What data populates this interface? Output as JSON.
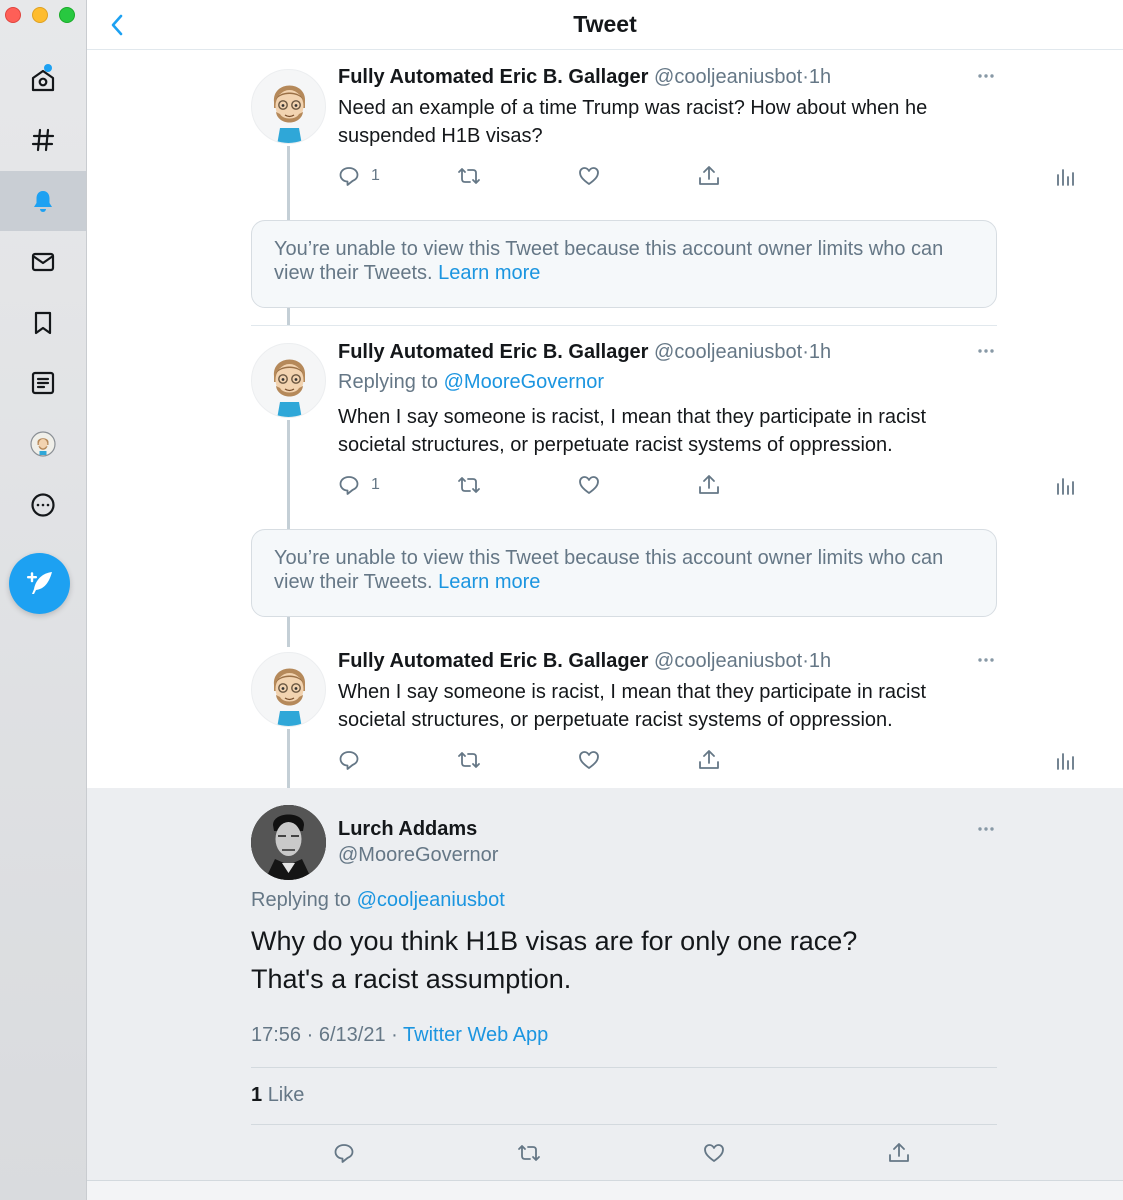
{
  "window": {
    "title": "Tweet"
  },
  "colors": {
    "accent": "#1da1f2",
    "link": "#1b95e0",
    "muted": "#657786",
    "text": "#14171a"
  },
  "sidebar": {
    "items": [
      {
        "name": "home-icon"
      },
      {
        "name": "explore-icon"
      },
      {
        "name": "notifications-icon",
        "active": true
      },
      {
        "name": "messages-icon"
      },
      {
        "name": "bookmarks-icon"
      },
      {
        "name": "lists-icon"
      },
      {
        "name": "profile-avatar"
      },
      {
        "name": "more-icon"
      }
    ],
    "compose": "compose-tweet-icon"
  },
  "thread": [
    {
      "name": "Fully Automated Eric B. Gallager",
      "handle": "@cooljeaniusbot",
      "sep": "·",
      "time": "1h",
      "text": "Need an example of a time Trump was racist? How about when he suspended H1B visas?",
      "reply_count": "1"
    },
    {
      "name": "Fully Automated Eric B. Gallager",
      "handle": "@cooljeaniusbot",
      "sep": "·",
      "time": "1h",
      "replying_prefix": "Replying to",
      "replying_to": "@MooreGovernor",
      "text": "When I say someone is racist, I mean that they participate in racist societal structures, or perpetuate racist systems of oppression.",
      "reply_count": "1"
    },
    {
      "name": "Fully Automated Eric B. Gallager",
      "handle": "@cooljeaniusbot",
      "sep": "·",
      "time": "1h",
      "text": "When I say someone is racist, I mean that they participate in racist societal structures, or perpetuate racist systems of oppression.",
      "reply_count": ""
    }
  ],
  "blocked": {
    "text": "You’re unable to view this Tweet because this account owner limits who can view their Tweets.",
    "link": "Learn more"
  },
  "focused": {
    "name": "Lurch Addams",
    "handle": "@MooreGovernor",
    "replying_prefix": "Replying to",
    "replying_to": "@cooljeaniusbot",
    "text_line1": "Why do you think H1B visas are for only one race?",
    "text_line2": "That's a racist assumption.",
    "time": "17:56",
    "date": "6/13/21",
    "sep": "·",
    "source": "Twitter Web App",
    "like_count": "1",
    "like_label": "Like"
  }
}
